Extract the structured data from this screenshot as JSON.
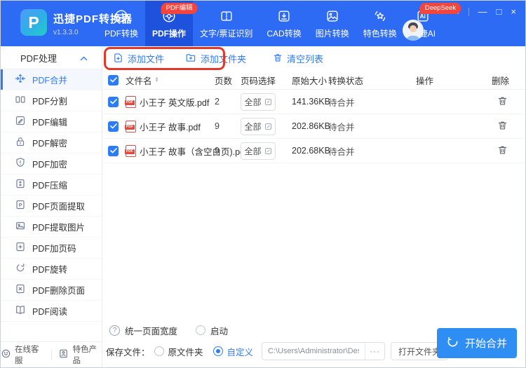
{
  "app": {
    "title": "迅捷PDF转换器",
    "version": "v1.3.3.0",
    "logo_letter": "P"
  },
  "header": {
    "nav": [
      {
        "label": "PDF转换"
      },
      {
        "label": "PDF操作",
        "badge": "PDF编辑",
        "active": true
      },
      {
        "label": "文字/票证识别"
      },
      {
        "label": "CAD转换"
      },
      {
        "label": "图片转换"
      },
      {
        "label": "特色转换"
      },
      {
        "label": "迅捷AI",
        "badge": "DeepSeek"
      }
    ],
    "window_controls": {
      "menu": "≡",
      "minimize": "—",
      "maximize": "□",
      "close": "×"
    }
  },
  "sidebar": {
    "group_title": "PDF处理",
    "items": [
      {
        "label": "PDF合并",
        "active": true
      },
      {
        "label": "PDF分割"
      },
      {
        "label": "PDF编辑"
      },
      {
        "label": "PDF解密"
      },
      {
        "label": "PDF加密"
      },
      {
        "label": "PDF压缩"
      },
      {
        "label": "PDF页面提取"
      },
      {
        "label": "PDF提取图片"
      },
      {
        "label": "PDF加页码"
      },
      {
        "label": "PDF旋转"
      },
      {
        "label": "PDF删除页面"
      },
      {
        "label": "PDF阅读"
      }
    ],
    "footer": {
      "service": "在线客服",
      "products": "特色产品"
    }
  },
  "toolbar": {
    "add_file": "添加文件",
    "add_folder": "添加文件夹",
    "clear_list": "清空列表"
  },
  "table": {
    "headers": {
      "name": "文件名",
      "pages": "页数",
      "page_select": "页码选择",
      "size": "原始大小",
      "status": "转换状态",
      "action": "操作",
      "delete": "删除"
    },
    "rows": [
      {
        "checked": true,
        "name": "小王子 英文版.pdf",
        "pages": "2",
        "page_select": "全部",
        "size": "141.36KB",
        "status": "待合并"
      },
      {
        "checked": true,
        "name": "小王子 故事.pdf",
        "pages": "9",
        "page_select": "全部",
        "size": "202.86KB",
        "status": "待合并"
      },
      {
        "checked": true,
        "name": "小王子 故事（含空白页).pdf",
        "pages": "9",
        "page_select": "全部",
        "size": "202.68KB",
        "status": "待合并"
      }
    ],
    "pdf_icon_label": "PDF"
  },
  "options": {
    "uniform_width": "统一页面宽度",
    "launch": "启动",
    "save_label": "保存文件：",
    "save_original": "原文件夹",
    "save_custom": "自定义",
    "path": "C:\\Users\\Administrator\\Desktop",
    "ellipsis": "···",
    "open_folder": "打开文件夹",
    "start_merge": "开始合并"
  },
  "colors": {
    "header_blue": "#2E6BF4",
    "active_tab_blue": "#1E52DC",
    "accent_blue": "#2E7CF5",
    "badge_red": "#F2453D",
    "annotation_red": "#E2382A",
    "start_button_blue": "#2F8EF4",
    "pdf_icon_red": "#E04A3F"
  }
}
